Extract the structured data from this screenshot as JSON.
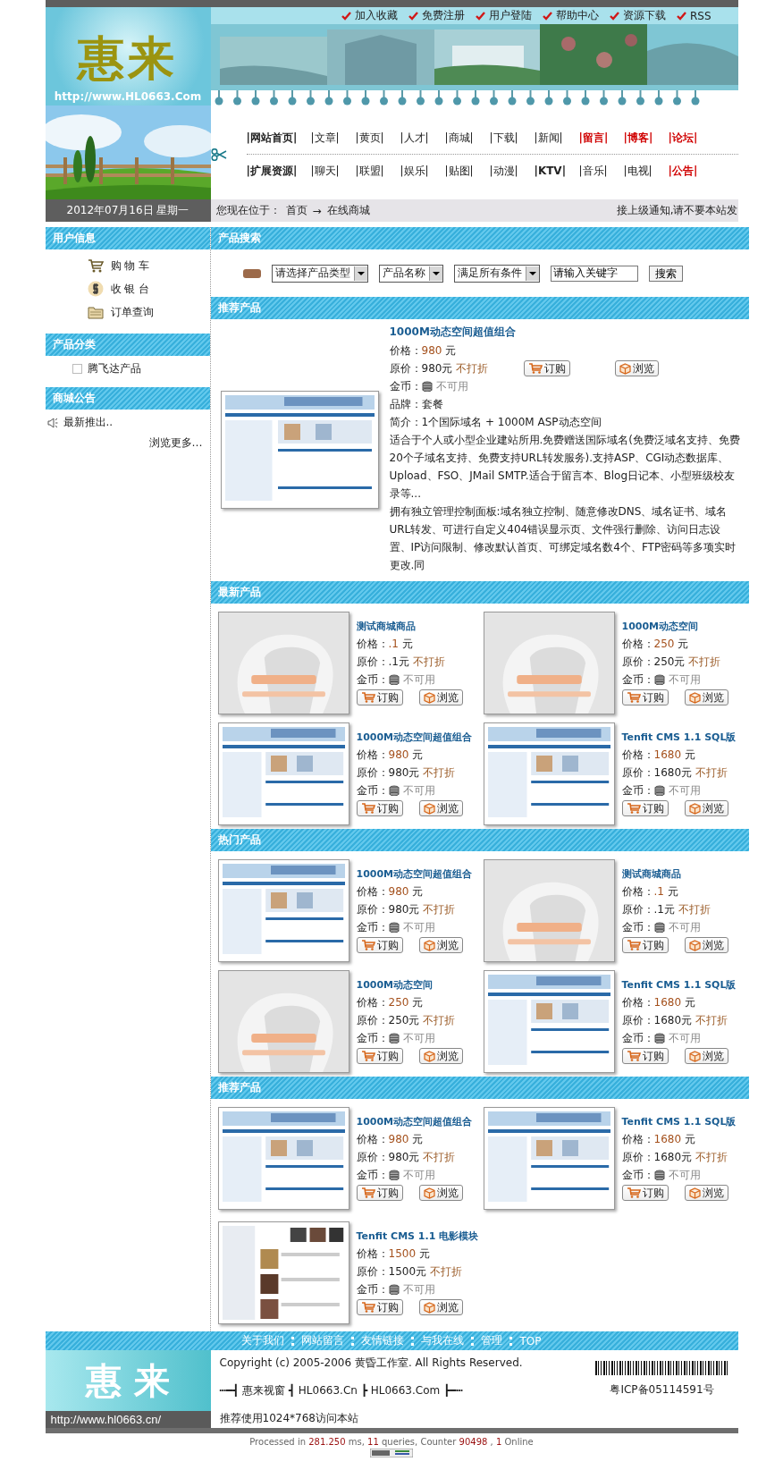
{
  "top_links": [
    "加入收藏",
    "免费注册",
    "用户登陆",
    "帮助中心",
    "资源下载",
    "RSS"
  ],
  "logo": {
    "name": "惠来",
    "url": "http://www.HL0663.Com"
  },
  "nav_rows": [
    [
      {
        "label": "|网站首页|",
        "kind": "bold"
      },
      {
        "label": "|文章|",
        "kind": "normal"
      },
      {
        "label": "|黄页|",
        "kind": "normal"
      },
      {
        "label": "|人才|",
        "kind": "normal"
      },
      {
        "label": "|商城|",
        "kind": "normal"
      },
      {
        "label": "|下载|",
        "kind": "normal"
      },
      {
        "label": "|新闻|",
        "kind": "normal"
      },
      {
        "label": "|留言|",
        "kind": "red"
      },
      {
        "label": "|博客|",
        "kind": "red"
      },
      {
        "label": "|论坛|",
        "kind": "red"
      }
    ],
    [
      {
        "label": "|扩展资源|",
        "kind": "bold"
      },
      {
        "label": "|聊天|",
        "kind": "normal"
      },
      {
        "label": "|联盟|",
        "kind": "normal"
      },
      {
        "label": "|娱乐|",
        "kind": "normal"
      },
      {
        "label": "|贴图|",
        "kind": "normal"
      },
      {
        "label": "|动漫|",
        "kind": "normal"
      },
      {
        "label": "|KTV|",
        "kind": "bold"
      },
      {
        "label": "|音乐|",
        "kind": "normal"
      },
      {
        "label": "|电视|",
        "kind": "normal"
      },
      {
        "label": "|公告|",
        "kind": "red"
      }
    ]
  ],
  "date": "2012年07月16日 星期一",
  "breadcrumb": {
    "label": "您现在位于：",
    "home": "首页",
    "arrow": "→",
    "current": "在线商城"
  },
  "notice": "接上级通知,请不要本站发",
  "sidebar": [
    {
      "title": "用户信息",
      "kind": "menu",
      "items": [
        {
          "label": "购 物 车"
        },
        {
          "label": "收 银 台"
        },
        {
          "label": "订单查询"
        }
      ]
    },
    {
      "title": "产品分类",
      "kind": "category",
      "items": [
        {
          "label": "腾飞达产品"
        }
      ]
    },
    {
      "title": "商城公告",
      "kind": "notice",
      "items": [
        {
          "label": "最新推出.."
        }
      ],
      "more": "浏览更多…"
    }
  ],
  "search": {
    "title": "产品搜索",
    "selects": [
      "请选择产品类型",
      "产品名称",
      "满足所有条件"
    ],
    "keyword": "请输入关键字",
    "button": "搜索"
  },
  "featured": {
    "title": "推荐产品",
    "product": {
      "name": "1000M动态空间超值组合",
      "price_label": "价格：",
      "price": "980",
      "unit": "元",
      "orig_label": "原价：",
      "orig": "980元",
      "discount": "不打折",
      "coin_label": "金币：",
      "coin": "不可用",
      "brand_label": "品牌：",
      "brand": "套餐",
      "intro_label": "简介：",
      "intro": "1个国际域名 + 1000M ASP动态空间",
      "paragraphs": [
        "适合于个人或小型企业建站所用.免费赠送国际域名(免费泛域名支持、免费20个子域名支持、免费支持URL转发服务).支持ASP、CGI动态数据库、Upload、FSO、JMail SMTP.适合于留言本、Blog日记本、小型班级校友录等...",
        "拥有独立管理控制面板:域名独立控制、随意修改DNS、域名证书、域名URL转发、可进行自定义404错误显示页、文件强行删除、访问日志设置、IP访问限制、修改默认首页、可绑定域名数4个、FTP密码等多项实时更改.同"
      ],
      "order": "订购",
      "browse": "浏览"
    }
  },
  "sections": [
    {
      "title": "最新产品",
      "products": [
        {
          "name": "测试商城商品",
          "price_label": "价格：",
          "price": ".1",
          "unit": "元",
          "orig_label": "原价：",
          "orig": ".1元",
          "discount": "不打折",
          "coin_label": "金币：",
          "coin": "不可用",
          "order": "订购",
          "browse": "浏览"
        },
        {
          "name": "1000M动态空间",
          "price_label": "价格：",
          "price": "250",
          "unit": "元",
          "orig_label": "原价：",
          "orig": "250元",
          "discount": "不打折",
          "coin_label": "金币：",
          "coin": "不可用",
          "order": "订购",
          "browse": "浏览"
        },
        {
          "name": "1000M动态空间超值组合",
          "price_label": "价格：",
          "price": "980",
          "unit": "元",
          "orig_label": "原价：",
          "orig": "980元",
          "discount": "不打折",
          "coin_label": "金币：",
          "coin": "不可用",
          "order": "订购",
          "browse": "浏览"
        },
        {
          "name": "Tenfit CMS 1.1 SQL版",
          "price_label": "价格：",
          "price": "1680",
          "unit": "元",
          "orig_label": "原价：",
          "orig": "1680元",
          "discount": "不打折",
          "coin_label": "金币：",
          "coin": "不可用",
          "order": "订购",
          "browse": "浏览"
        }
      ]
    },
    {
      "title": "热门产品",
      "products": [
        {
          "name": "1000M动态空间超值组合",
          "price_label": "价格：",
          "price": "980",
          "unit": "元",
          "orig_label": "原价：",
          "orig": "980元",
          "discount": "不打折",
          "coin_label": "金币：",
          "coin": "不可用",
          "order": "订购",
          "browse": "浏览"
        },
        {
          "name": "测试商城商品",
          "price_label": "价格：",
          "price": ".1",
          "unit": "元",
          "orig_label": "原价：",
          "orig": ".1元",
          "discount": "不打折",
          "coin_label": "金币：",
          "coin": "不可用",
          "order": "订购",
          "browse": "浏览"
        },
        {
          "name": "1000M动态空间",
          "price_label": "价格：",
          "price": "250",
          "unit": "元",
          "orig_label": "原价：",
          "orig": "250元",
          "discount": "不打折",
          "coin_label": "金币：",
          "coin": "不可用",
          "order": "订购",
          "browse": "浏览"
        },
        {
          "name": "Tenfit CMS 1.1 SQL版",
          "price_label": "价格：",
          "price": "1680",
          "unit": "元",
          "orig_label": "原价：",
          "orig": "1680元",
          "discount": "不打折",
          "coin_label": "金币：",
          "coin": "不可用",
          "order": "订购",
          "browse": "浏览"
        }
      ]
    },
    {
      "title": "推荐产品",
      "products": [
        {
          "name": "1000M动态空间超值组合",
          "price_label": "价格：",
          "price": "980",
          "unit": "元",
          "orig_label": "原价：",
          "orig": "980元",
          "discount": "不打折",
          "coin_label": "金币：",
          "coin": "不可用",
          "order": "订购",
          "browse": "浏览"
        },
        {
          "name": "Tenfit CMS 1.1 SQL版",
          "price_label": "价格：",
          "price": "1680",
          "unit": "元",
          "orig_label": "原价：",
          "orig": "1680元",
          "discount": "不打折",
          "coin_label": "金币：",
          "coin": "不可用",
          "order": "订购",
          "browse": "浏览"
        },
        {
          "name": "Tenfit CMS 1.1 电影模块",
          "price_label": "价格：",
          "price": "1500",
          "unit": "元",
          "orig_label": "原价：",
          "orig": "1500元",
          "discount": "不打折",
          "coin_label": "金币：",
          "coin": "不可用",
          "order": "订购",
          "browse": "浏览"
        }
      ]
    }
  ],
  "footer": {
    "links": [
      "关于我们",
      "网站留言",
      "友情链接",
      "与我在线",
      "管理",
      "TOP"
    ],
    "logo": "惠 来",
    "url": "http://www.hl0663.cn/",
    "copyright": "Copyright (c) 2005-2006 黄昏工作室. All Rights Reserved.",
    "sites": "┅━┫ 惠来视窗 ┫ HL0663.Cn ┣ HL0663.Com ┣━┅",
    "recommend": "推荐使用1024*768访问本站",
    "icp": "粤ICP备05114591号"
  },
  "stats": [
    {
      "text": "Processed in ",
      "kind": "plain"
    },
    {
      "text": "281.250",
      "kind": "number"
    },
    {
      "text": " ms, ",
      "kind": "plain"
    },
    {
      "text": "11",
      "kind": "number"
    },
    {
      "text": " queries, Counter ",
      "kind": "plain"
    },
    {
      "text": "90498",
      "kind": "number"
    },
    {
      "text": " , ",
      "kind": "plain"
    },
    {
      "text": "1",
      "kind": "number"
    },
    {
      "text": " Online",
      "kind": "plain"
    }
  ]
}
